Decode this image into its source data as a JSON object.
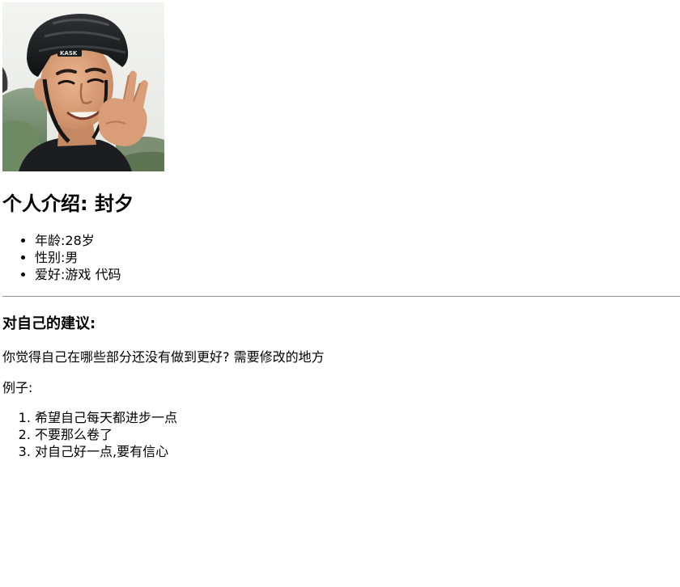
{
  "profile": {
    "intro_heading": "个人介绍: 封夕",
    "details": [
      "年龄:28岁",
      "性别:男",
      "爱好:游戏 代码"
    ]
  },
  "suggestions": {
    "heading": "对自己的建议:",
    "question": "你觉得自己在哪些部分还没有做到更好? 需要修改的地方",
    "example_label": "例子:",
    "items": [
      "希望自己每天都进步一点",
      "不要那么卷了",
      "对自己好一点,要有信心"
    ]
  },
  "helmet_text": "KASK"
}
